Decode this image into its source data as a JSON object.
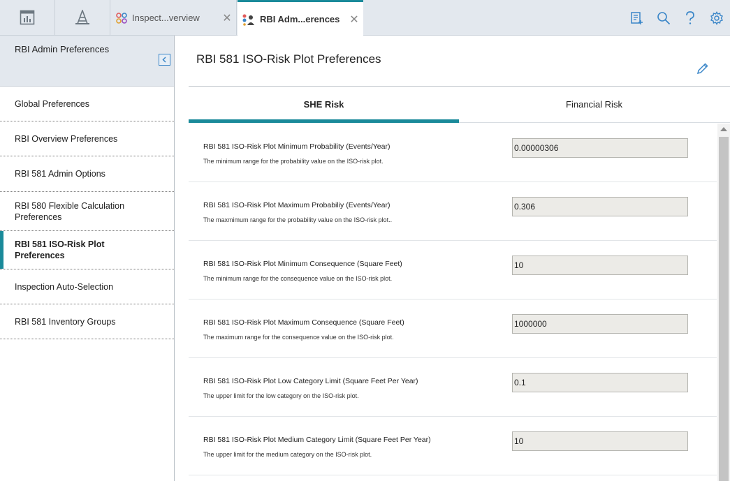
{
  "topbar": {
    "tabs": [
      {
        "label": "Inspect...verview",
        "active": false
      },
      {
        "label": "RBI Adm...erences",
        "active": true
      }
    ],
    "close_symbol": "✕"
  },
  "sidebar": {
    "title": "RBI Admin Preferences",
    "items": [
      {
        "label": "Global Preferences"
      },
      {
        "label": "RBI Overview Preferences"
      },
      {
        "label": "RBI 581 Admin Options"
      },
      {
        "label": "RBI 580 Flexible Calculation Preferences"
      },
      {
        "label": "RBI 581 ISO-Risk Plot Preferences",
        "active": true
      },
      {
        "label": "Inspection Auto-Selection"
      },
      {
        "label": "RBI 581 Inventory Groups"
      }
    ]
  },
  "main": {
    "title": "RBI 581 ISO-Risk Plot Preferences",
    "subtabs": [
      {
        "label": "SHE Risk",
        "active": true
      },
      {
        "label": "Financial Risk",
        "active": false
      }
    ],
    "prefs": [
      {
        "label": "RBI 581 ISO-Risk Plot Minimum Probability (Events/Year)",
        "desc": "The minimum range for the probability value on the ISO-risk plot.",
        "value": "0.00000306"
      },
      {
        "label": "RBI 581 ISO-Risk Plot Maximum Probabiliy (Events/Year)",
        "desc": "The maxmimum range for the probability value on the ISO-risk plot..",
        "value": "0.306"
      },
      {
        "label": "RBI 581 ISO-Risk Plot Minimum Consequence (Square Feet)",
        "desc": "The minimum range for the consequence value on the ISO-risk plot.",
        "value": "10"
      },
      {
        "label": "RBI 581 ISO-Risk Plot Maximum Consequence (Square Feet)",
        "desc": "The maximum range for the consequence value on the ISO-risk plot.",
        "value": "1000000"
      },
      {
        "label": "RBI 581 ISO-Risk Plot Low Category Limit (Square Feet Per Year)",
        "desc": "The upper limit for the low category on the ISO-risk plot.",
        "value": "0.1"
      },
      {
        "label": "RBI 581 ISO-Risk Plot Medium Category Limit (Square Feet Per Year)",
        "desc": "The upper limit for the medium category on the ISO-risk plot.",
        "value": "10"
      }
    ]
  },
  "colors": {
    "accent": "#1a8a9a",
    "topbar_bg": "#e3e8ee",
    "icon_blue": "#3a86c8"
  }
}
